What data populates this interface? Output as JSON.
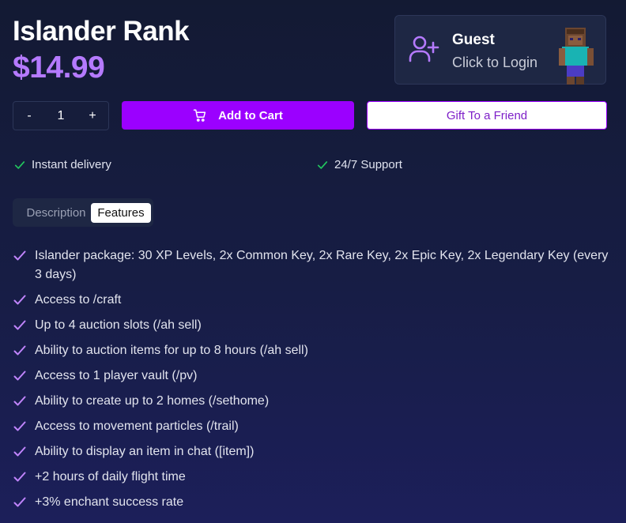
{
  "product": {
    "title": "Islander Rank",
    "price": "$14.99"
  },
  "user": {
    "name": "Guest",
    "login_text": "Click to Login",
    "avatar_icon": "add-user-icon"
  },
  "quantity": {
    "minus_label": "-",
    "value": "1",
    "plus_label": "+"
  },
  "actions": {
    "add_to_cart": "Add to Cart",
    "gift": "Gift To a Friend"
  },
  "perks": [
    "Instant delivery",
    "24/7 Support"
  ],
  "tabs": {
    "description": "Description",
    "features": "Features",
    "active": "Features"
  },
  "features": [
    "Islander package: 30 XP Levels, 2x Common Key, 2x Rare Key, 2x Epic Key, 2x Legendary Key (every 3 days)",
    "Access to /craft",
    "Up to 4 auction slots (/ah sell)",
    "Ability to auction items for up to 8 hours (/ah sell)",
    "Access to 1 player vault (/pv)",
    "Ability to create up to 2 homes (/sethome)",
    "Access to movement particles (/trail)",
    "Ability to display an item in chat ([item])",
    "+2 hours of daily flight time",
    "+3% enchant success rate"
  ],
  "colors": {
    "accent": "#9b00ff",
    "price": "#b57aff",
    "check_green": "#22c55e",
    "check_purple": "#c084fc",
    "card_bg": "#1e2744"
  }
}
